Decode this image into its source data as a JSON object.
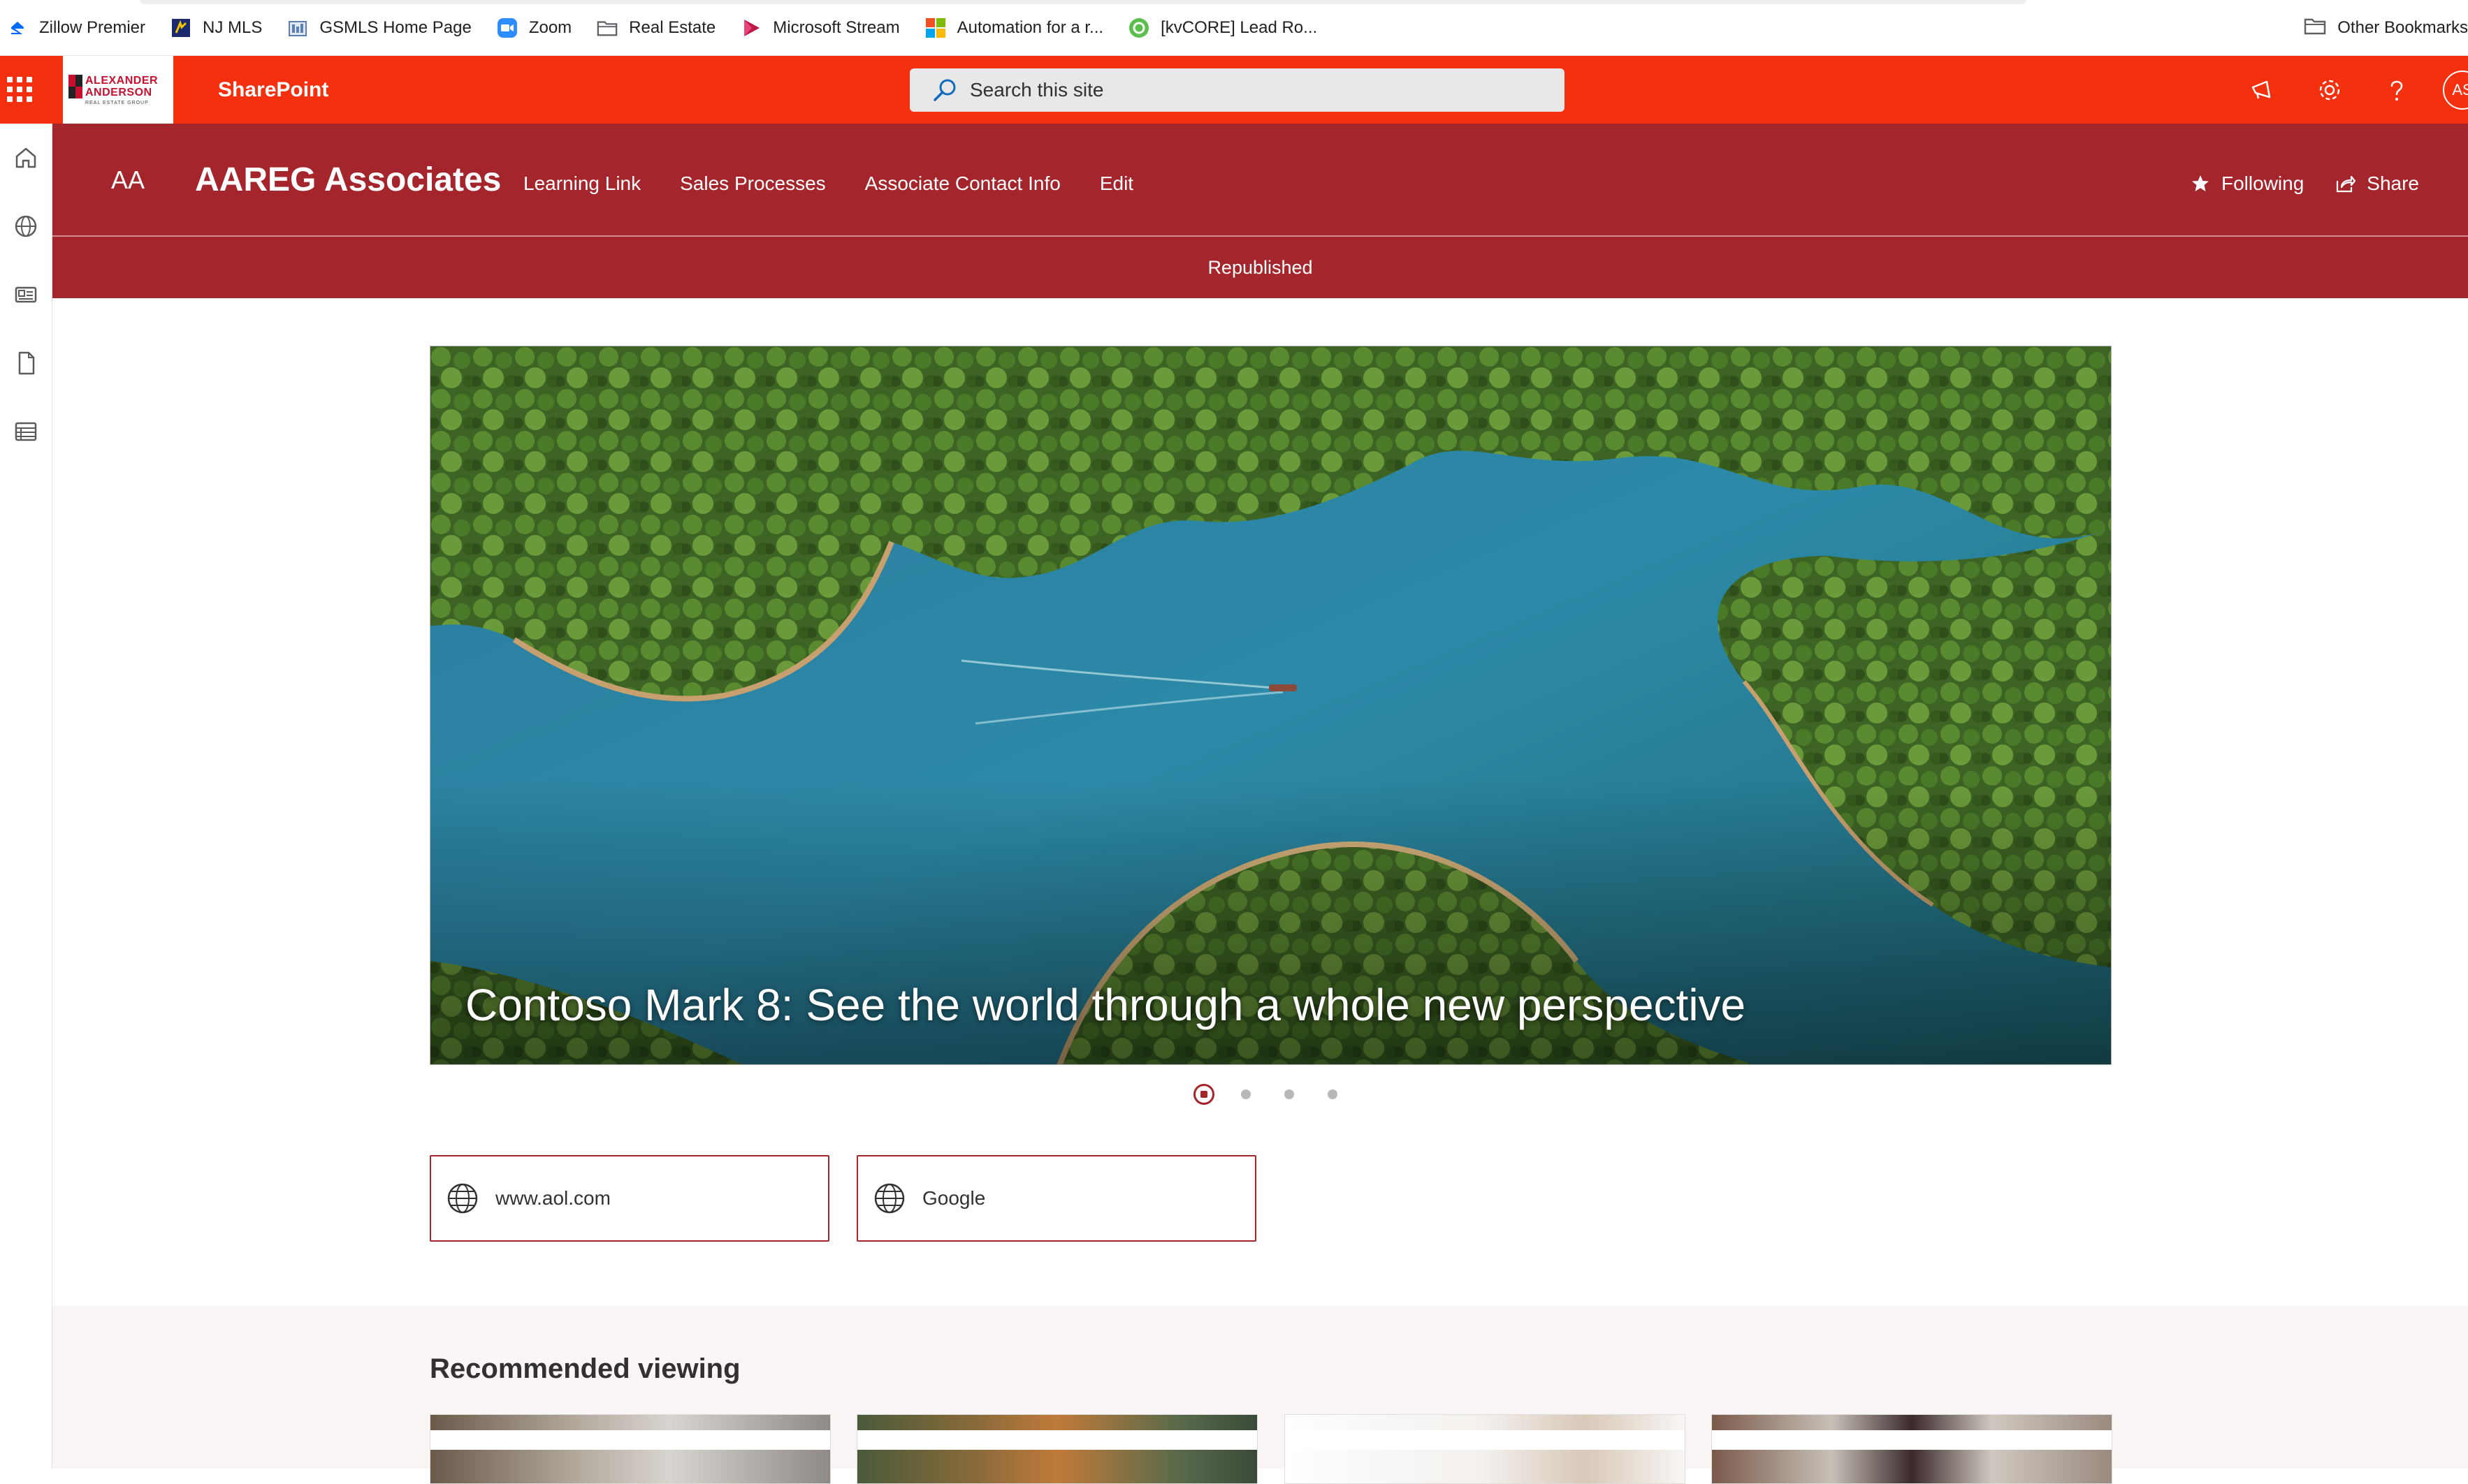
{
  "bookmarks": {
    "items": [
      {
        "label": "Zillow Premier",
        "icon": "zillow-icon"
      },
      {
        "label": "NJ MLS",
        "icon": "njmls-icon"
      },
      {
        "label": "GSMLS Home Page",
        "icon": "gsmls-icon"
      },
      {
        "label": "Zoom",
        "icon": "zoom-icon"
      },
      {
        "label": "Real Estate",
        "icon": "folder-icon"
      },
      {
        "label": "Microsoft Stream",
        "icon": "stream-icon"
      },
      {
        "label": "Automation for a r...",
        "icon": "microsoft-icon"
      },
      {
        "label": "[kvCORE] Lead Ro...",
        "icon": "kvcore-icon"
      }
    ],
    "other": "Other Bookmarks"
  },
  "suitebar": {
    "app_name": "SharePoint",
    "logo_line1": "ALEXANDER",
    "logo_line2": "ANDERSON",
    "logo_line3": "REAL ESTATE GROUP",
    "search_placeholder": "Search this site",
    "avatar_initials": "AS",
    "accent": "#f5300f"
  },
  "site": {
    "logo_initials": "AA",
    "title": "AAREG Associates",
    "nav": [
      "Learning Link",
      "Sales Processes",
      "Associate Contact Info",
      "Edit"
    ],
    "following": "Following",
    "share": "Share",
    "status": "Republished",
    "theme": "#a4262c"
  },
  "hero": {
    "title": "Contoso Mark 8: See the world through a whole new perspective",
    "slides": 4,
    "active_slide": 1
  },
  "quick_links": [
    {
      "label": "www.aol.com",
      "icon": "globe-icon"
    },
    {
      "label": "Google",
      "icon": "globe-icon"
    }
  ],
  "recommended": {
    "title": "Recommended viewing"
  }
}
